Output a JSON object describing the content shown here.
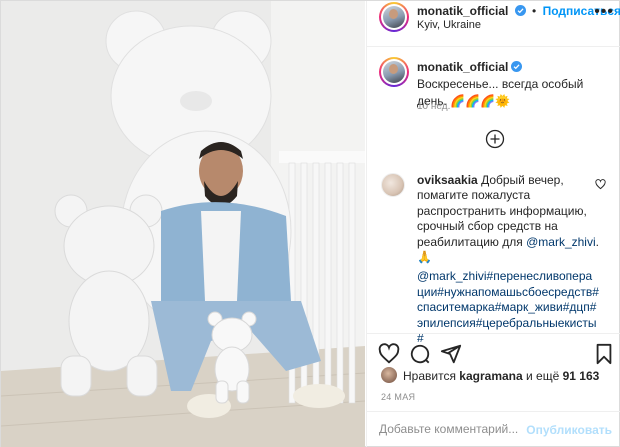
{
  "post": {
    "author": {
      "username": "monatik_official",
      "verified": true,
      "follow_label": "Подписаться",
      "location": "Kyiv, Ukraine",
      "more_label": "•••"
    },
    "caption": {
      "username": "monatik_official",
      "text": "Воскресенье... всегда особый день. 🌈🌈🌈🌞",
      "time": "10 нед."
    },
    "comments": [
      {
        "username": "oviksaakia",
        "text_before": "Добрый вечер, помагите пожалуста распространить информацию, срочный сбор средств на реабилитацию для ",
        "mention1": "@mark_zhivi",
        "text_middle": ". 🙏",
        "hashtags": "@mark_zhivi#перенесливоперации#нужнапомашьсбоесредств#спаситемарка#марк_живи#дцп#эпилепсия#церебральныекисты#"
      }
    ],
    "likes": {
      "prefix": "Нравится ",
      "user": "kagramana",
      "middle": " и ещё ",
      "count": "91 163"
    },
    "date": "24 МАЯ",
    "comment_input": {
      "placeholder": "Добавьте комментарий...",
      "submit_label": "Опубликовать"
    },
    "icons": [
      "heart-icon",
      "comment-icon",
      "share-icon",
      "bookmark-icon",
      "plus-circle-icon",
      "verified-icon",
      "more-icon"
    ],
    "colors": {
      "accent": "#0095f6",
      "mention": "#00376b",
      "muted": "#8e8e8e",
      "publish_disabled": "#b2dffc"
    }
  }
}
